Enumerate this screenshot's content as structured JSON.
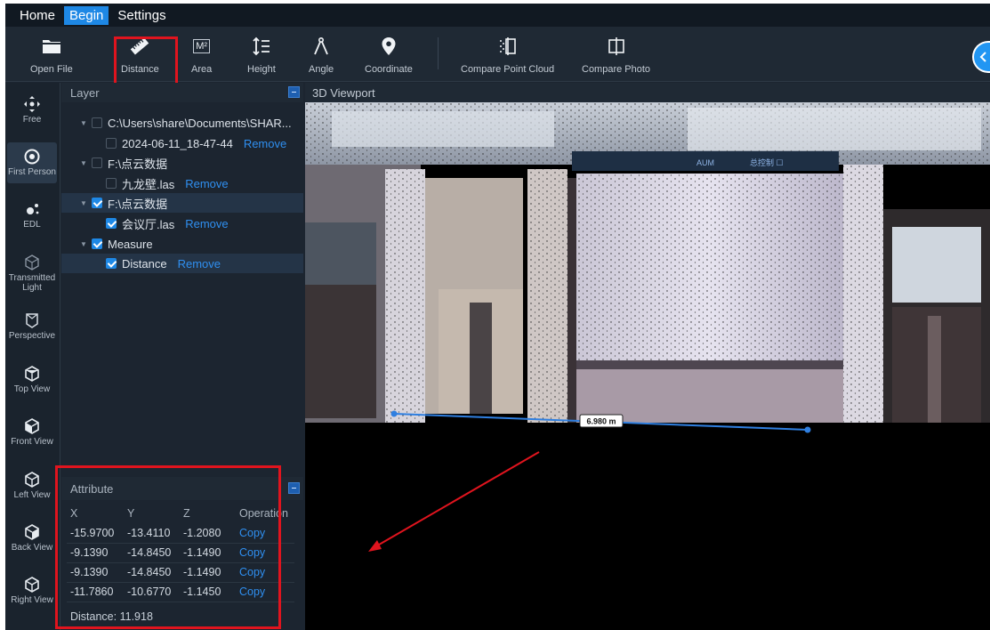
{
  "menu": {
    "home": "Home",
    "begin": "Begin",
    "settings": "Settings"
  },
  "toolbar": {
    "open_file": "Open File",
    "distance": "Distance",
    "area": "Area",
    "area_icon_text": "M²",
    "height": "Height",
    "angle": "Angle",
    "coordinate": "Coordinate",
    "compare_point_cloud": "Compare Point Cloud",
    "compare_photo": "Compare Photo"
  },
  "nav": {
    "free": "Free",
    "first_person": "First Person",
    "edl": "EDL",
    "transmitted_light": "Transmitted Light",
    "perspective": "Perspective",
    "top_view": "Top View",
    "front_view": "Front View",
    "left_view": "Left View",
    "back_view": "Back View",
    "right_view": "Right View"
  },
  "layer": {
    "title": "Layer",
    "rows": [
      {
        "label": "C:\\Users\\share\\Documents\\SHAR...",
        "checked": false,
        "remove": ""
      },
      {
        "label": "2024-06-11_18-47-44",
        "checked": false,
        "remove": "Remove"
      },
      {
        "label": "F:\\点云数据",
        "checked": false,
        "remove": ""
      },
      {
        "label": "九龙壁.las",
        "checked": false,
        "remove": "Remove"
      },
      {
        "label": "F:\\点云数据",
        "checked": true,
        "remove": ""
      },
      {
        "label": "会议厅.las",
        "checked": true,
        "remove": "Remove"
      },
      {
        "label": "Measure",
        "checked": true,
        "remove": ""
      },
      {
        "label": "Distance",
        "checked": true,
        "remove": "Remove"
      }
    ]
  },
  "attribute": {
    "title": "Attribute",
    "headers": {
      "x": "X",
      "y": "Y",
      "z": "Z",
      "op": "Operation"
    },
    "rows": [
      {
        "x": "-15.9700",
        "y": "-13.4110",
        "z": "-1.2080",
        "op": "Copy"
      },
      {
        "x": "-9.1390",
        "y": "-14.8450",
        "z": "-1.1490",
        "op": "Copy"
      },
      {
        "x": "-9.1390",
        "y": "-14.8450",
        "z": "-1.1490",
        "op": "Copy"
      },
      {
        "x": "-11.7860",
        "y": "-10.6770",
        "z": "-1.1450",
        "op": "Copy"
      }
    ],
    "distance_label": "Distance:",
    "distance_value": "11.918"
  },
  "viewport": {
    "title": "3D Viewport",
    "measurement_label": "6.980 m",
    "sign_1": "AUM",
    "sign_2": "总控制 ☐"
  },
  "colors": {
    "accent": "#1e88e5",
    "link": "#2f8ff0",
    "highlight_box": "#e0141e",
    "measure_line": "#2f7fe0"
  }
}
